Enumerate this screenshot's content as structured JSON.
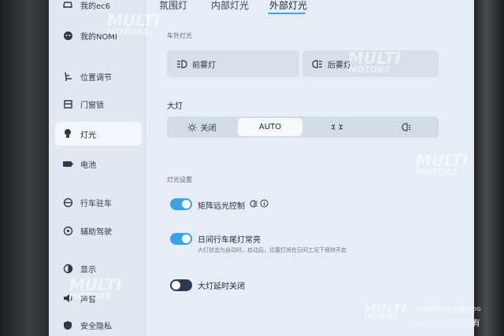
{
  "sidebar": {
    "items": [
      {
        "label": "我的ec6",
        "icon": "car-icon"
      },
      {
        "label": "我的NOMI",
        "icon": "nomi-icon"
      },
      {
        "label": "位置调节",
        "icon": "seat-icon"
      },
      {
        "label": "门窗锁",
        "icon": "door-icon"
      },
      {
        "label": "灯光",
        "icon": "bulb-icon"
      },
      {
        "label": "电池",
        "icon": "battery-icon"
      },
      {
        "label": "行车驻车",
        "icon": "drive-icon"
      },
      {
        "label": "辅助驾驶",
        "icon": "assist-icon"
      },
      {
        "label": "显示",
        "icon": "display-icon"
      },
      {
        "label": "声音",
        "icon": "speaker-icon"
      },
      {
        "label": "安全隐私",
        "icon": "shield-icon"
      }
    ],
    "active_index": 4
  },
  "tabs": [
    {
      "label": "氛围灯"
    },
    {
      "label": "内部灯光"
    },
    {
      "label": "外部灯光"
    }
  ],
  "active_tab": 2,
  "exterior": {
    "section_label": "车外灯光",
    "front_fog": "前雾灯",
    "rear_fog": "后雾灯"
  },
  "headlight": {
    "label": "大灯",
    "options": [
      {
        "label": "关闭",
        "icon": "sun-off-icon"
      },
      {
        "label": "AUTO",
        "icon": ""
      },
      {
        "label": "",
        "icon": "parking-light-icon"
      },
      {
        "label": "",
        "icon": "low-beam-icon"
      }
    ],
    "selected": "AUTO"
  },
  "settings": {
    "section_label": "灯光设置",
    "rows": [
      {
        "title": "矩阵远光控制",
        "desc": "",
        "on": true
      },
      {
        "title": "日间行车尾灯常亮",
        "desc": "大灯状态为自动时，启动后，位置灯将在日间工况下保持开启",
        "on": true
      },
      {
        "title": "大灯延时关闭",
        "desc": "",
        "on": false
      }
    ]
  },
  "watermarks": {
    "brand": "MULTI",
    "brand2": "MOTORS",
    "catalog": "CARPICKER KATALOG",
    "credit": "©xin.com 版权所有"
  },
  "colors": {
    "accent": "#3aa3e8",
    "toggle_off": "#2d3b52",
    "screen_bg": "#e6edf4"
  }
}
